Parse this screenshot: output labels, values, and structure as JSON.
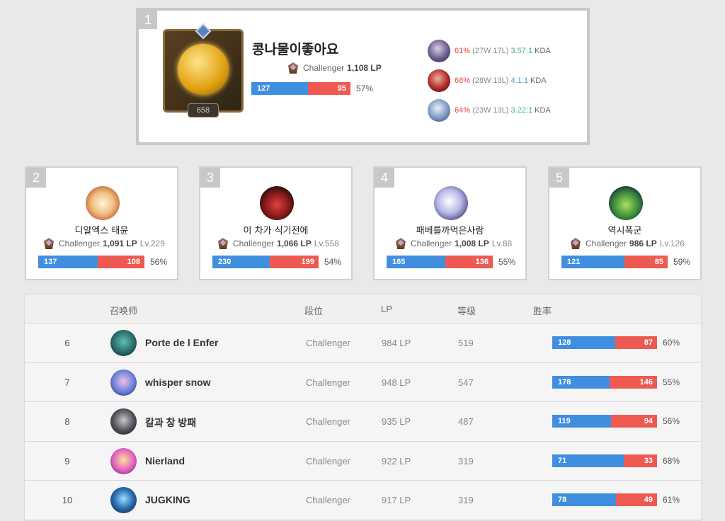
{
  "top": {
    "rank": "1",
    "name": "콩나물이좋아요",
    "level": "658",
    "tier": "Challenger",
    "lp": "1,108 LP",
    "wins": "127",
    "losses": "95",
    "winrate": "57%",
    "win_fraction": 0.57,
    "champions": [
      {
        "pct": "61%",
        "record": "(27W 17L)",
        "kda": "3.57:1",
        "kda_color": "green",
        "kda_tail": "KDA"
      },
      {
        "pct": "68%",
        "record": "(28W 13L)",
        "kda": "4.1:1",
        "kda_color": "blue",
        "kda_tail": "KDA"
      },
      {
        "pct": "64%",
        "record": "(23W 13L)",
        "kda": "3.22:1",
        "kda_color": "green",
        "kda_tail": "KDA"
      }
    ]
  },
  "cards": [
    {
      "rank": "2",
      "name": "디알엑스 태윤",
      "tier": "Challenger",
      "lp": "1,091 LP",
      "lv": "Lv.229",
      "wins": "137",
      "losses": "108",
      "winrate": "56%",
      "win_fraction": 0.56
    },
    {
      "rank": "3",
      "name": "이 차가 식기전에",
      "tier": "Challenger",
      "lp": "1,066 LP",
      "lv": "Lv.558",
      "wins": "230",
      "losses": "199",
      "winrate": "54%",
      "win_fraction": 0.54
    },
    {
      "rank": "4",
      "name": "패베를까먹은사람",
      "tier": "Challenger",
      "lp": "1,008 LP",
      "lv": "Lv.88",
      "wins": "165",
      "losses": "136",
      "winrate": "55%",
      "win_fraction": 0.55
    },
    {
      "rank": "5",
      "name": "역시폭군",
      "tier": "Challenger",
      "lp": "986 LP",
      "lv": "Lv.126",
      "wins": "121",
      "losses": "85",
      "winrate": "59%",
      "win_fraction": 0.59
    }
  ],
  "table": {
    "headers": {
      "summoner": "召唤师",
      "tier": "段位",
      "lp": "LP",
      "level": "等级",
      "winrate": "胜率"
    },
    "rows": [
      {
        "rank": "6",
        "name": "Porte de l Enfer",
        "tier": "Challenger",
        "lp": "984 LP",
        "level": "519",
        "wins": "128",
        "losses": "87",
        "winrate": "60%",
        "win_fraction": 0.6
      },
      {
        "rank": "7",
        "name": "whisper snow",
        "tier": "Challenger",
        "lp": "948 LP",
        "level": "547",
        "wins": "178",
        "losses": "146",
        "winrate": "55%",
        "win_fraction": 0.55
      },
      {
        "rank": "8",
        "name": "칼과 창 방패",
        "tier": "Challenger",
        "lp": "935 LP",
        "level": "487",
        "wins": "119",
        "losses": "94",
        "winrate": "56%",
        "win_fraction": 0.56
      },
      {
        "rank": "9",
        "name": "Nierland",
        "tier": "Challenger",
        "lp": "922 LP",
        "level": "319",
        "wins": "71",
        "losses": "33",
        "winrate": "68%",
        "win_fraction": 0.68
      },
      {
        "rank": "10",
        "name": "JUGKING",
        "tier": "Challenger",
        "lp": "917 LP",
        "level": "319",
        "wins": "78",
        "losses": "49",
        "winrate": "61%",
        "win_fraction": 0.61
      }
    ]
  },
  "colors": {
    "win": "#3f8ee0",
    "loss": "#ee5a52",
    "badge": "#c8c8c8"
  }
}
